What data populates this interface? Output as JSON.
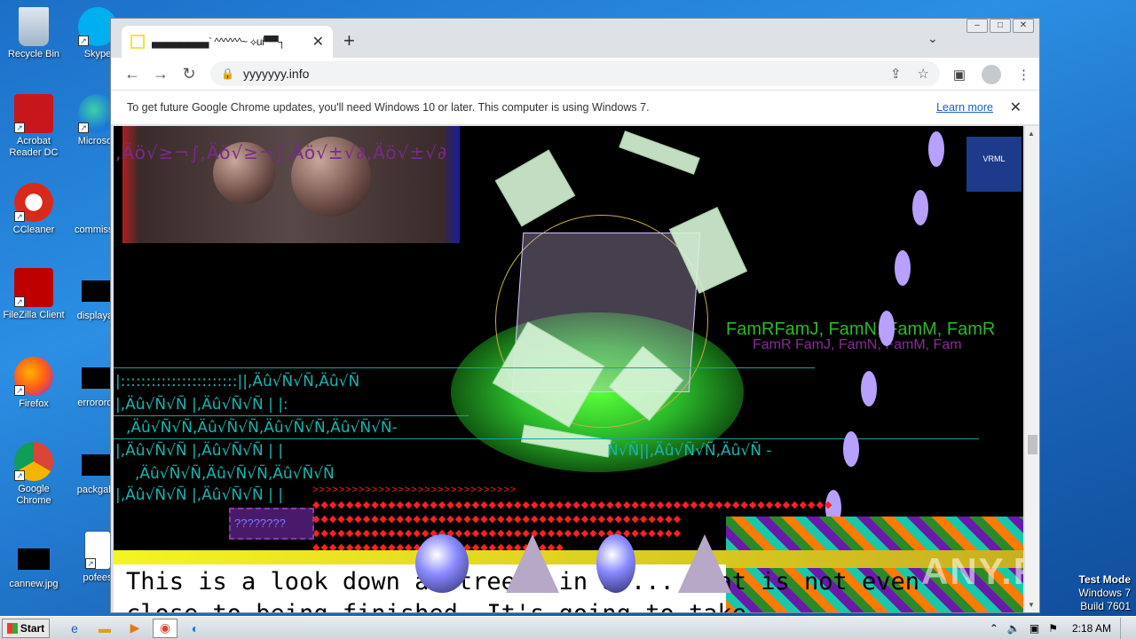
{
  "desktop": {
    "icons_left": [
      {
        "label": "Recycle Bin",
        "icon": "recycle-bin-icon"
      },
      {
        "label": "Acrobat Reader DC",
        "icon": "acrobat-icon"
      },
      {
        "label": "CCleaner",
        "icon": "ccleaner-icon"
      },
      {
        "label": "FileZilla Client",
        "icon": "filezilla-icon"
      },
      {
        "label": "Firefox",
        "icon": "firefox-icon"
      },
      {
        "label": "Google Chrome",
        "icon": "chrome-icon"
      },
      {
        "label": "cannew.jpg",
        "icon": "image-file-icon"
      }
    ],
    "icons_right": [
      {
        "label": "Skype",
        "icon": "skype-icon"
      },
      {
        "label": "Microsoft",
        "icon": "edge-icon"
      },
      {
        "label": "commissio",
        "icon": "file-icon"
      },
      {
        "label": "displayau",
        "icon": "file-icon"
      },
      {
        "label": "errororde",
        "icon": "file-icon"
      },
      {
        "label": "packgalle",
        "icon": "file-icon"
      },
      {
        "label": "pofees",
        "icon": "word-icon"
      }
    ]
  },
  "browser": {
    "tab_title": "▄▄▄▄▄▄▄▄` ^^^^^^~ ⟡ui▀▀┐",
    "url": "yyyyyyy.info",
    "infobar_message": "To get future Google Chrome updates, you'll need Windows 10 or later. This computer is using Windows 7.",
    "infobar_link": "Learn more",
    "new_tab_label": "+",
    "window_buttons": [
      "–",
      "□",
      "✕"
    ]
  },
  "page": {
    "glitch_header": ",Äö√≥¬∫,Äö√≥¬∫,Äö√±√∂,Äö√±√∂",
    "vrml_label": "VRML",
    "cyan_lines": [
      "|:::::::::::::::::::::::||,Äû√Ñ√Ñ,Äû√Ñ",
      "|,Äû√Ñ√Ñ |,Äû√Ñ√Ñ | |:",
      ",Äû√Ñ√Ñ,Äû√Ñ√Ñ,Äû√Ñ√Ñ,Äû√Ñ√Ñ-",
      "|,Äû√Ñ√Ñ |,Äû√Ñ√Ñ | |",
      ",Äû√Ñ√Ñ,Äû√Ñ√Ñ,Äû√Ñ√Ñ",
      "|,Äû√Ñ√Ñ |,Äû√Ñ√Ñ | |"
    ],
    "cyan_right": "Ñ√Ñ||,Äû√Ñ√Ñ,Äû√Ñ -",
    "fam_text": "FamRFamJ, FamN, FamM, FamR",
    "fam_text2": "FamR FamJ, FamN, FamM, Fam",
    "purple_text": "????????",
    "big_text_line1": "This is a look down a street, in a ... that is not even",
    "big_text_line2": "close to being finished. It's going to take ...",
    "watermark": "ANY.RUN"
  },
  "taskbar": {
    "start_label": "Start",
    "clock": "2:18 AM",
    "apps": [
      "ie-icon",
      "explorer-icon",
      "media-player-icon",
      "chrome-icon",
      "edge-icon"
    ]
  },
  "os_watermark": {
    "line1": "Test Mode",
    "line2": "Windows 7",
    "line3": "Build 7601"
  }
}
